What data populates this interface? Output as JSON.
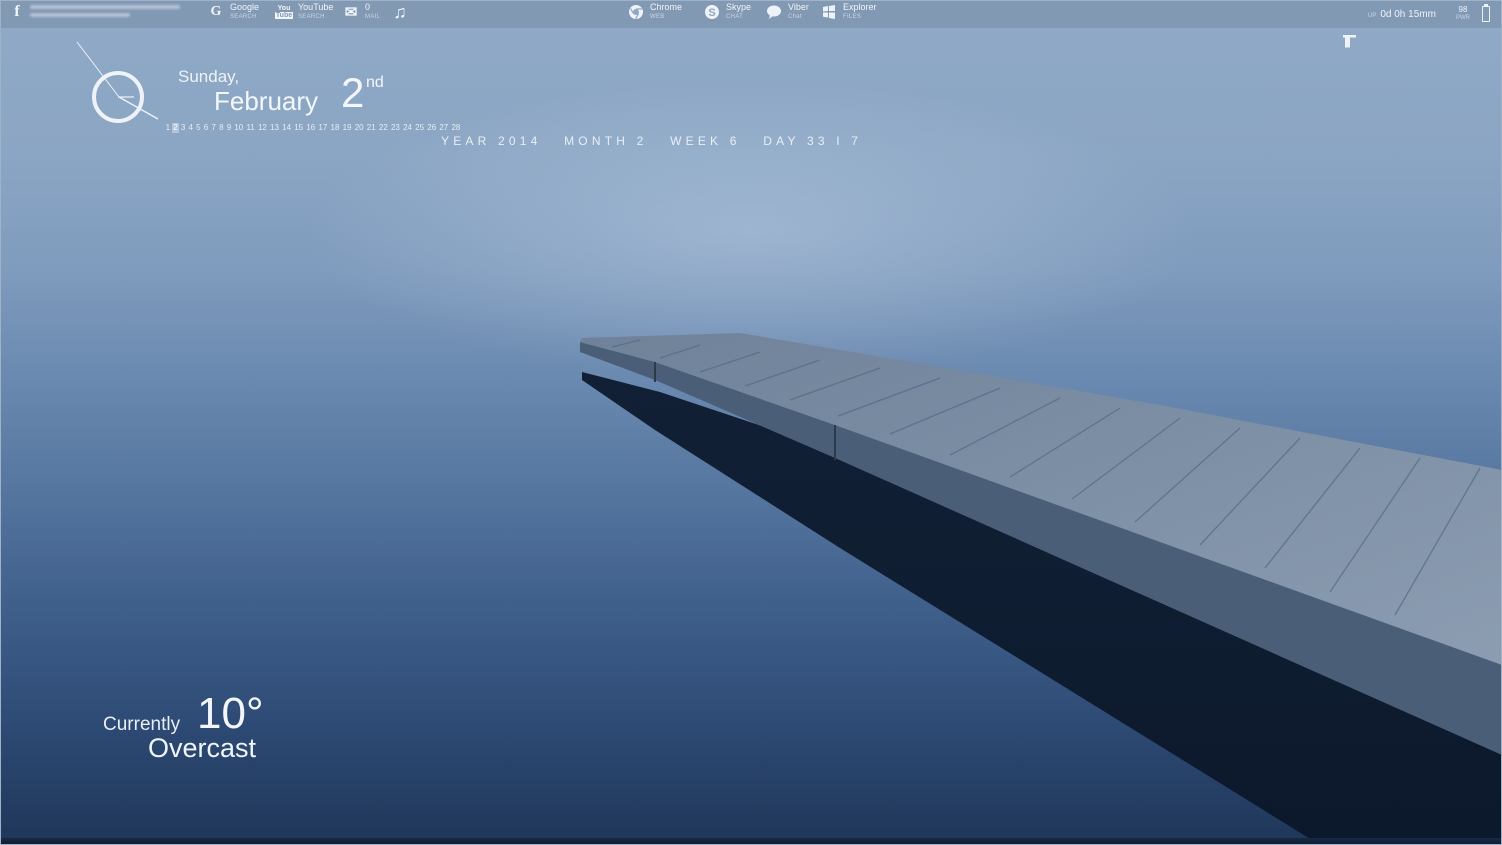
{
  "topbar": {
    "facebook_icon": "facebook-icon",
    "left_items": [
      {
        "name": "google",
        "icon": "G",
        "label": "Google",
        "sub": "SEARCH"
      },
      {
        "name": "youtube",
        "icon": "You",
        "label": "YouTube",
        "sub": "SEARCH"
      },
      {
        "name": "mail",
        "icon": "✉",
        "label": "0",
        "sub": "MAIL"
      },
      {
        "name": "music",
        "icon": "♫",
        "label": "",
        "sub": ""
      }
    ],
    "center_items": [
      {
        "name": "chrome",
        "label": "Chrome",
        "sub": "WEB"
      },
      {
        "name": "skype",
        "label": "Skype",
        "sub": "CHAT"
      },
      {
        "name": "viber",
        "label": "Viber",
        "sub": "Chat"
      },
      {
        "name": "explorer",
        "label": "Explorer",
        "sub": "FILES"
      }
    ],
    "uptime_label": "UP",
    "uptime_value": "0d 0h 15mm",
    "power_value": "98",
    "power_label": "PWR"
  },
  "datetime": {
    "day_name": "Sunday,",
    "month_name": "February",
    "day_number": "2",
    "day_suffix": "nd",
    "calendar_days": [
      "1",
      "2",
      "3",
      "4",
      "5",
      "6",
      "7",
      "8",
      "9",
      "10",
      "11",
      "12",
      "13",
      "14",
      "15",
      "16",
      "17",
      "18",
      "19",
      "20",
      "21",
      "22",
      "23",
      "24",
      "25",
      "26",
      "27",
      "28"
    ],
    "selected_day": "2",
    "date_codes": "YEAR 2014   MONTH 2   WEEK 6   DAY 33 I 7"
  },
  "weather": {
    "currently_label": "Currently",
    "temperature": "10°",
    "condition": "Overcast"
  }
}
